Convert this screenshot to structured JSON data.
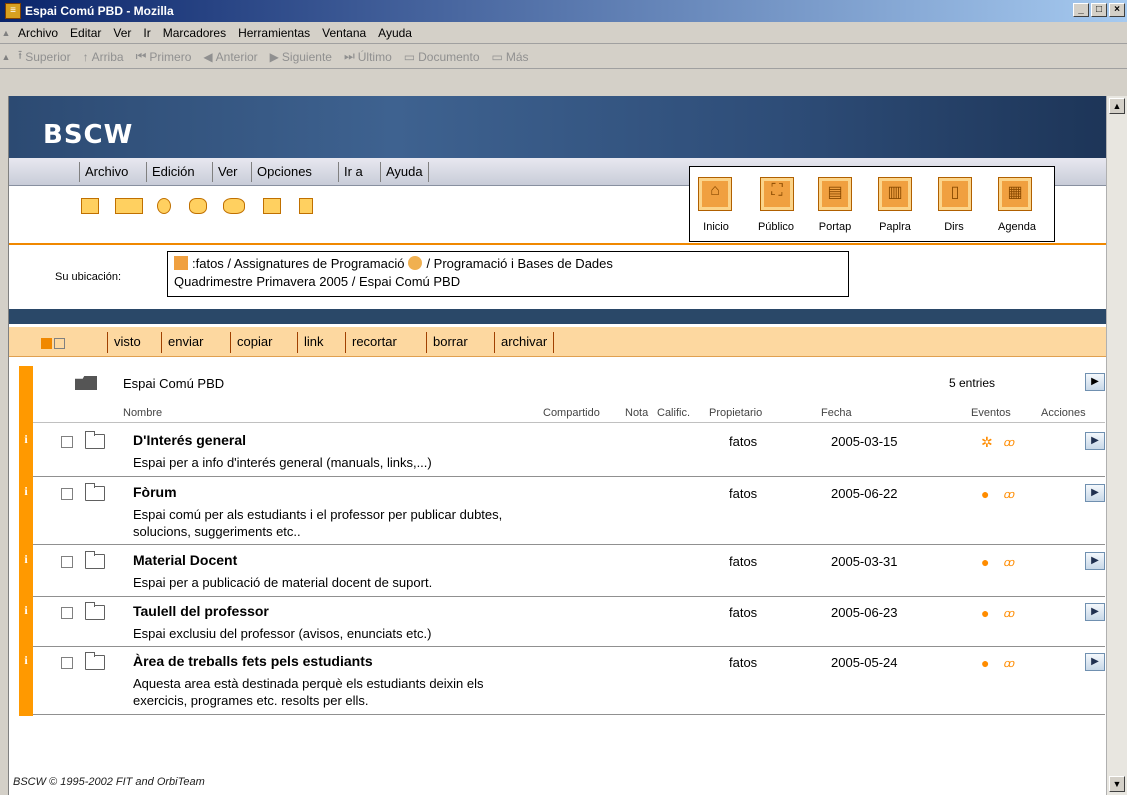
{
  "window": {
    "title": "Espai Comú PBD - Mozilla"
  },
  "menubar": [
    "Archivo",
    "Editar",
    "Ver",
    "Ir",
    "Marcadores",
    "Herramientas",
    "Ventana",
    "Ayuda"
  ],
  "navbar": [
    {
      "icon": "up-arrow-icon",
      "glyph": "⭱",
      "label": "Superior"
    },
    {
      "icon": "up-arrow-icon",
      "glyph": "↑",
      "label": "Arriba"
    },
    {
      "icon": "first-icon",
      "glyph": "⏮",
      "label": "Primero"
    },
    {
      "icon": "previous-icon",
      "glyph": "◀",
      "label": "Anterior"
    },
    {
      "icon": "next-icon",
      "glyph": "▶",
      "label": "Siguiente"
    },
    {
      "icon": "last-icon",
      "glyph": "⏭",
      "label": "Último"
    },
    {
      "icon": "document-folder-icon",
      "glyph": "▭",
      "label": "Documento"
    },
    {
      "icon": "more-folder-icon",
      "glyph": "▭",
      "label": "Más"
    }
  ],
  "app": {
    "logo": "BSCW",
    "menu": [
      "Archivo",
      "Edición",
      "Ver",
      "Opciones",
      "Ir a",
      "Ayuda"
    ],
    "big_icons": [
      {
        "label": "Inicio",
        "icon": "home-icon",
        "glyph": "⌂"
      },
      {
        "label": "Público",
        "icon": "public-icon",
        "glyph": "⛶"
      },
      {
        "label": "Portap",
        "icon": "clipboard-icon",
        "glyph": "▤"
      },
      {
        "label": "Paplra",
        "icon": "wastebasket-icon",
        "glyph": "▥"
      },
      {
        "label": "Dirs",
        "icon": "directory-icon",
        "glyph": "▯"
      },
      {
        "label": "Agenda",
        "icon": "agenda-icon",
        "glyph": "▦"
      }
    ],
    "location_label": "Su ubicación:",
    "location_line1_a": ":fatos / Assignatures de Programació",
    "location_line1_b": "/ Programació i Bases de Dades",
    "location_line2": "Quadrimestre Primavera 2005 / Espai Comú PBD",
    "actions": [
      "visto",
      "enviar",
      "copiar",
      "link",
      "recortar",
      "borrar",
      "archivar"
    ],
    "folder_title": "Espai Comú PBD",
    "entries_count": "5 entries",
    "columns": {
      "nombre": "Nombre",
      "compartido": "Compartido",
      "nota": "Nota",
      "calific": "Calific.",
      "propietario": "Propietario",
      "fecha": "Fecha",
      "eventos": "Eventos",
      "acciones": "Acciones"
    },
    "rows": [
      {
        "name": "D'Interés general",
        "desc": "Espai per a info d'interés general (manuals, links,...)",
        "owner": "fatos",
        "date": "2005-03-15"
      },
      {
        "name": "Fòrum",
        "desc": "Espai comú per als estudiants i el professor per publicar dubtes, solucions, suggeriments etc..",
        "owner": "fatos",
        "date": "2005-06-22"
      },
      {
        "name": "Material Docent",
        "desc": "Espai per a publicació de material docent de suport.",
        "owner": "fatos",
        "date": "2005-03-31"
      },
      {
        "name": "Taulell del professor",
        "desc": "Espai exclusiu del professor (avisos, enunciats etc.)",
        "owner": "fatos",
        "date": "2005-06-23"
      },
      {
        "name": "Àrea de treballs fets pels estudiants",
        "desc": "Aquesta area està destinada perquè els estudiants deixin els exercicis, programes etc. resolts per ells.",
        "owner": "fatos",
        "date": "2005-05-24"
      }
    ],
    "footer": "BSCW © 1995-2002 FIT and OrbiTeam"
  },
  "colors": {
    "accent": "#ff9900",
    "banner": "#2c4a72"
  }
}
